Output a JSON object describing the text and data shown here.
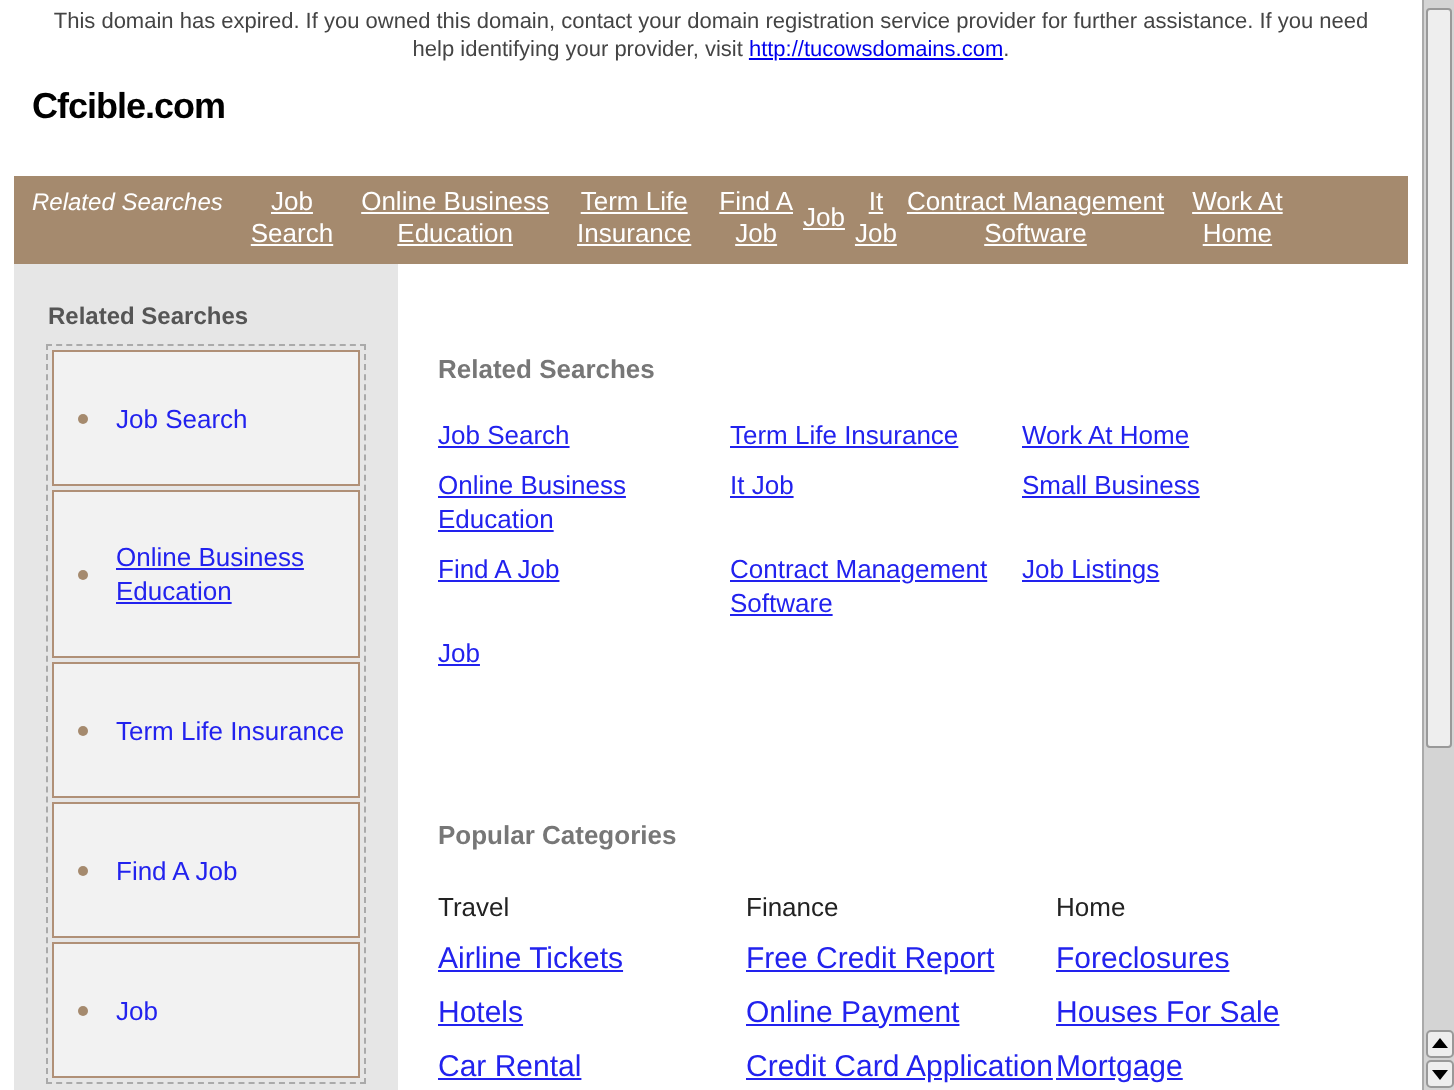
{
  "notice": {
    "text": "This domain has expired. If you owned this domain, contact your domain registration service provider for further assistance. If you need help identifying your provider, visit ",
    "link": "http://tucowsdomains.com",
    "end": "."
  },
  "site_title": "Cfcible.com",
  "nav": {
    "label": "Related Searches",
    "links": [
      {
        "lines": [
          "Job",
          "Search"
        ]
      },
      {
        "lines": [
          "Online Business",
          "Education"
        ]
      },
      {
        "lines": [
          "Term Life",
          "Insurance"
        ]
      },
      {
        "lines": [
          "Find A",
          "Job"
        ]
      },
      {
        "lines": [
          "Job"
        ]
      },
      {
        "lines": [
          "It",
          "Job"
        ]
      },
      {
        "lines": [
          "Contract Management",
          "Software"
        ]
      },
      {
        "lines": [
          "Work At",
          "Home"
        ]
      }
    ]
  },
  "sidebar": {
    "title": "Related Searches",
    "items": [
      {
        "lines": [
          "Job Search"
        ]
      },
      {
        "lines": [
          "Online Business",
          "Education"
        ]
      },
      {
        "lines": [
          "Term Life Insurance"
        ]
      },
      {
        "lines": [
          "Find A Job"
        ]
      },
      {
        "lines": [
          "Job"
        ]
      }
    ]
  },
  "related": {
    "title": "Related Searches",
    "links": [
      {
        "lines": [
          "Job Search"
        ]
      },
      {
        "lines": [
          "Term Life Insurance"
        ]
      },
      {
        "lines": [
          "Work At Home"
        ]
      },
      {
        "lines": [
          "Online Business",
          "Education"
        ]
      },
      {
        "lines": [
          "It Job"
        ]
      },
      {
        "lines": [
          "Small Business"
        ]
      },
      {
        "lines": [
          "Find A Job"
        ]
      },
      {
        "lines": [
          "Contract Management",
          "Software"
        ]
      },
      {
        "lines": [
          "Job Listings"
        ]
      },
      {
        "lines": [
          "Job"
        ]
      }
    ]
  },
  "popular": {
    "title": "Popular Categories",
    "columns": [
      {
        "heading": "Travel",
        "links": [
          "Airline Tickets",
          "Hotels",
          "Car Rental"
        ]
      },
      {
        "heading": "Finance",
        "links": [
          "Free Credit Report",
          "Online Payment",
          "Credit Card Application"
        ]
      },
      {
        "heading": "Home",
        "links": [
          "Foreclosures",
          "Houses For Sale",
          "Mortgage"
        ]
      }
    ]
  }
}
